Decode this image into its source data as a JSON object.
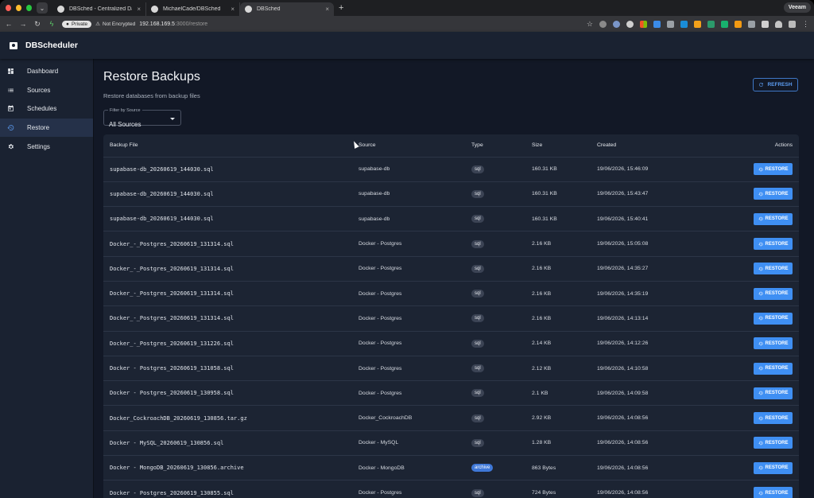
{
  "browser": {
    "tabs": [
      {
        "title": "DBSched - Centralized Database",
        "active": false
      },
      {
        "title": "MichaelCade/DBSched",
        "active": false
      },
      {
        "title": "DBSched",
        "active": true
      }
    ],
    "profile": "Veeam",
    "private_label": "Private",
    "security_label": "Not Encrypted",
    "url_host": "192.168.169.5",
    "url_path": ":3000/restore"
  },
  "app": {
    "brand": "DBScheduler"
  },
  "sidebar": {
    "items": [
      {
        "label": "Dashboard",
        "icon": "dashboard-icon",
        "active": false
      },
      {
        "label": "Sources",
        "icon": "list-icon",
        "active": false
      },
      {
        "label": "Schedules",
        "icon": "calendar-icon",
        "active": false
      },
      {
        "label": "Restore",
        "icon": "history-icon",
        "active": true
      },
      {
        "label": "Settings",
        "icon": "gear-icon",
        "active": false
      }
    ]
  },
  "main": {
    "title": "Restore Backups",
    "subtitle": "Restore databases from backup files",
    "refresh_label": "REFRESH",
    "filter": {
      "label": "Filter by Source",
      "value": "All Sources"
    },
    "table": {
      "headers": [
        "Backup File",
        "Source",
        "Type",
        "Size",
        "Created",
        "Actions"
      ],
      "action_label": "RESTORE",
      "rows": [
        {
          "file": "supabase-db_20260619_144030.sql",
          "source": "supabase-db",
          "type": "sql",
          "size": "160.31 KB",
          "created": "19/06/2026, 15:46:09"
        },
        {
          "file": "supabase-db_20260619_144030.sql",
          "source": "supabase-db",
          "type": "sql",
          "size": "160.31 KB",
          "created": "19/06/2026, 15:43:47"
        },
        {
          "file": "supabase-db_20260619_144030.sql",
          "source": "supabase-db",
          "type": "sql",
          "size": "160.31 KB",
          "created": "19/06/2026, 15:40:41"
        },
        {
          "file": "Docker_-_Postgres_20260619_131314.sql",
          "source": "Docker - Postgres",
          "type": "sql",
          "size": "2.16 KB",
          "created": "19/06/2026, 15:05:08"
        },
        {
          "file": "Docker_-_Postgres_20260619_131314.sql",
          "source": "Docker - Postgres",
          "type": "sql",
          "size": "2.16 KB",
          "created": "19/06/2026, 14:35:27"
        },
        {
          "file": "Docker_-_Postgres_20260619_131314.sql",
          "source": "Docker - Postgres",
          "type": "sql",
          "size": "2.16 KB",
          "created": "19/06/2026, 14:35:19"
        },
        {
          "file": "Docker_-_Postgres_20260619_131314.sql",
          "source": "Docker - Postgres",
          "type": "sql",
          "size": "2.16 KB",
          "created": "19/06/2026, 14:13:14"
        },
        {
          "file": "Docker_-_Postgres_20260619_131226.sql",
          "source": "Docker - Postgres",
          "type": "sql",
          "size": "2.14 KB",
          "created": "19/06/2026, 14:12:26"
        },
        {
          "file": "Docker - Postgres_20260619_131058.sql",
          "source": "Docker - Postgres",
          "type": "sql",
          "size": "2.12 KB",
          "created": "19/06/2026, 14:10:58"
        },
        {
          "file": "Docker - Postgres_20260619_130958.sql",
          "source": "Docker - Postgres",
          "type": "sql",
          "size": "2.1 KB",
          "created": "19/06/2026, 14:09:58"
        },
        {
          "file": "Docker_CockroachDB_20260619_130856.tar.gz",
          "source": "Docker_CockroachDB",
          "type": "sql",
          "size": "2.92 KB",
          "created": "19/06/2026, 14:08:56"
        },
        {
          "file": "Docker - MySQL_20260619_130856.sql",
          "source": "Docker - MySQL",
          "type": "sql",
          "size": "1.28 KB",
          "created": "19/06/2026, 14:08:56"
        },
        {
          "file": "Docker - MongoDB_20260619_130856.archive",
          "source": "Docker - MongoDB",
          "type": "archive",
          "size": "863 Bytes",
          "created": "19/06/2026, 14:08:56"
        },
        {
          "file": "Docker - Postgres_20260619_130855.sql",
          "source": "Docker - Postgres",
          "type": "sql",
          "size": "724 Bytes",
          "created": "19/06/2026, 14:08:56"
        }
      ]
    }
  }
}
